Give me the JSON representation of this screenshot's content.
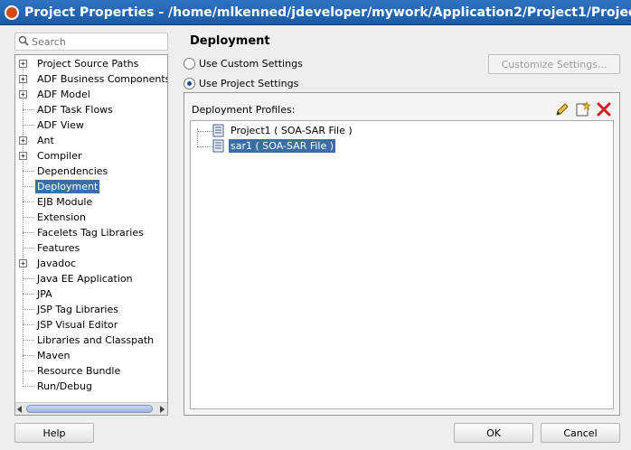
{
  "window": {
    "title": "Project Properties - /home/mlkenned/jdeveloper/mywork/Application2/Project1/Projec"
  },
  "search": {
    "placeholder": "Search"
  },
  "tree": {
    "items": [
      {
        "label": "Project Source Paths",
        "expandable": true
      },
      {
        "label": "ADF Business Components",
        "expandable": true
      },
      {
        "label": "ADF Model",
        "expandable": true
      },
      {
        "label": "ADF Task Flows",
        "expandable": false
      },
      {
        "label": "ADF View",
        "expandable": false
      },
      {
        "label": "Ant",
        "expandable": true
      },
      {
        "label": "Compiler",
        "expandable": true
      },
      {
        "label": "Dependencies",
        "expandable": false
      },
      {
        "label": "Deployment",
        "expandable": false,
        "selected": true
      },
      {
        "label": "EJB Module",
        "expandable": false
      },
      {
        "label": "Extension",
        "expandable": false
      },
      {
        "label": "Facelets Tag Libraries",
        "expandable": false
      },
      {
        "label": "Features",
        "expandable": false
      },
      {
        "label": "Javadoc",
        "expandable": true
      },
      {
        "label": "Java EE Application",
        "expandable": false
      },
      {
        "label": "JPA",
        "expandable": false
      },
      {
        "label": "JSP Tag Libraries",
        "expandable": false
      },
      {
        "label": "JSP Visual Editor",
        "expandable": false
      },
      {
        "label": "Libraries and Classpath",
        "expandable": false
      },
      {
        "label": "Maven",
        "expandable": false
      },
      {
        "label": "Resource Bundle",
        "expandable": false
      },
      {
        "label": "Run/Debug",
        "expandable": false
      }
    ]
  },
  "content": {
    "title": "Deployment",
    "radio_custom": "Use Custom Settings",
    "radio_project": "Use Project Settings",
    "customize_button": "Customize Settings...",
    "profiles_label": "Deployment Profiles:",
    "profiles": [
      {
        "label": "Project1 ( SOA-SAR File )",
        "selected": false
      },
      {
        "label": "sar1 ( SOA-SAR File )",
        "selected": true
      }
    ]
  },
  "buttons": {
    "help": "Help",
    "ok": "OK",
    "cancel": "Cancel"
  },
  "colors": {
    "title_bar": "#1d5aa6",
    "selection": "#3a6ea5"
  }
}
